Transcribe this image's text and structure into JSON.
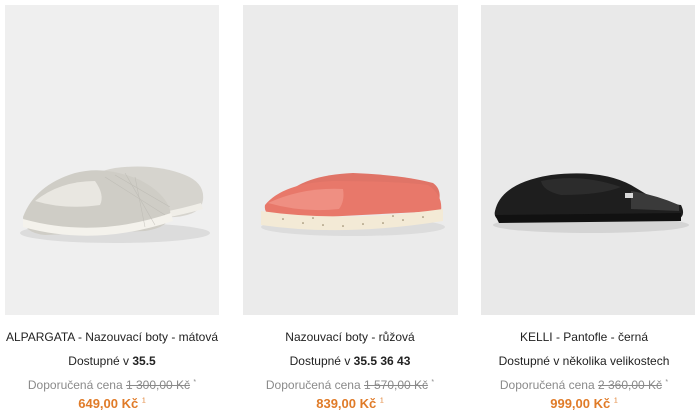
{
  "products": [
    {
      "name": "ALPARGATA - Nazouvací boty - mátová",
      "availability_prefix": "Dostupné v ",
      "availability_sizes": "35.5",
      "rrp_label": "Doporučená cena ",
      "rrp_value": "1 300,00 Kč",
      "rrp_note": "*",
      "price": "649,00 Kč",
      "price_note": "1",
      "image_icon": "canvas-slip-on-shoe-icon",
      "image_color": "#dcdad4"
    },
    {
      "name": "Nazouvací boty - růžová",
      "availability_prefix": "Dostupné v ",
      "availability_sizes": "35.5 36 43",
      "rrp_label": "Doporučená cena ",
      "rrp_value": "1 570,00 Kč",
      "rrp_note": "*",
      "price": "839,00 Kč",
      "price_note": "1",
      "image_icon": "canvas-slip-on-shoe-icon",
      "image_color": "#e8786a"
    },
    {
      "name": "KELLI - Pantofle - černá",
      "availability_prefix": "Dostupné v několika velikostech",
      "availability_sizes": "",
      "rrp_label": "Doporučená cena ",
      "rrp_value": "2 360,00 Kč",
      "rrp_note": "*",
      "price": "999,00 Kč",
      "price_note": "1",
      "image_icon": "slipper-icon",
      "image_color": "#1e1e1e"
    }
  ],
  "colors": {
    "price": "#e07b28",
    "rrp": "#8a8a8a",
    "text": "#222222"
  }
}
